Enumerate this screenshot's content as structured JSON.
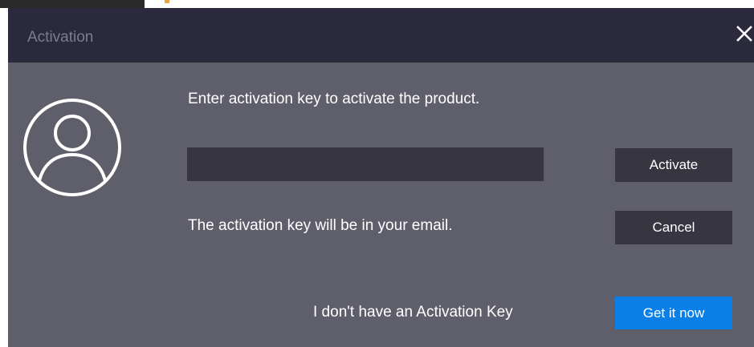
{
  "dialog": {
    "title": "Activation",
    "prompt": "Enter activation key to activate the product.",
    "key_input": {
      "value": "",
      "placeholder": ""
    },
    "hint": "The activation key will be in your email.",
    "no_key_text": "I don't have an Activation Key",
    "buttons": {
      "activate": "Activate",
      "cancel": "Cancel",
      "get_it_now": "Get it now"
    }
  },
  "icons": {
    "close": "close-icon",
    "avatar": "user-avatar-icon"
  },
  "colors": {
    "titlebar": "#2a2a3c",
    "body": "#5f5f6b",
    "input": "#363540",
    "button": "#363540",
    "primary_button": "#0a7fe8",
    "title_text": "#7a7d8c",
    "text": "#ffffff"
  }
}
